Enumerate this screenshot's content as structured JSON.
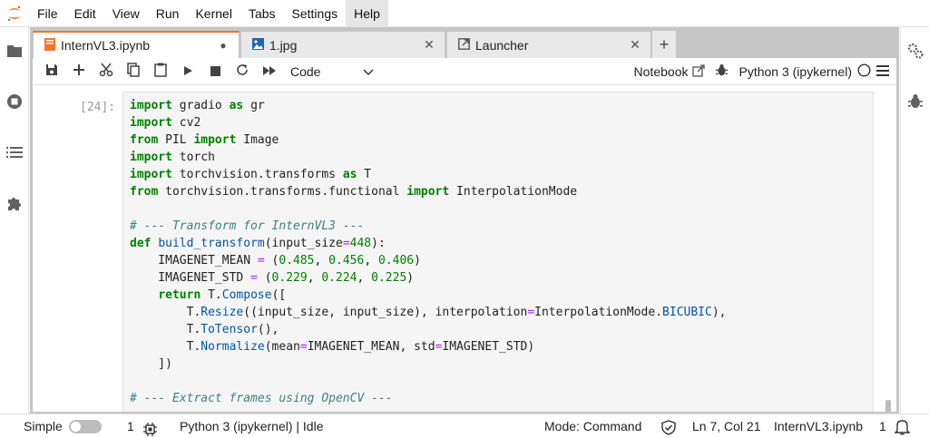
{
  "menu": [
    "File",
    "Edit",
    "View",
    "Run",
    "Kernel",
    "Tabs",
    "Settings",
    "Help"
  ],
  "active_menu": "Help",
  "tabs": [
    {
      "label": "InternVL3.ipynb",
      "icon": "notebook-icon",
      "modified": true,
      "close": "●"
    },
    {
      "label": "1.jpg",
      "icon": "image-icon",
      "close": "✕"
    },
    {
      "label": "Launcher",
      "icon": "launcher-icon",
      "close": "✕"
    }
  ],
  "add_tab": "+",
  "toolbar": {
    "cell_type": "Code",
    "notebook_label": "Notebook",
    "kernel_label": "Python 3 (ipykernel)"
  },
  "cell": {
    "prompt": "[24]:"
  },
  "status": {
    "mode_label": "Simple",
    "terminals": "1",
    "kernel_status": "Python 3 (ipykernel) | Idle",
    "mode": "Mode: Command",
    "cursor": "Ln 7, Col 21",
    "file": "InternVL3.ipynb",
    "notifications": "1"
  },
  "colors": {
    "accent": "#f37626",
    "keyword": "#008000",
    "function": "#0055aa",
    "comment": "#408080"
  }
}
